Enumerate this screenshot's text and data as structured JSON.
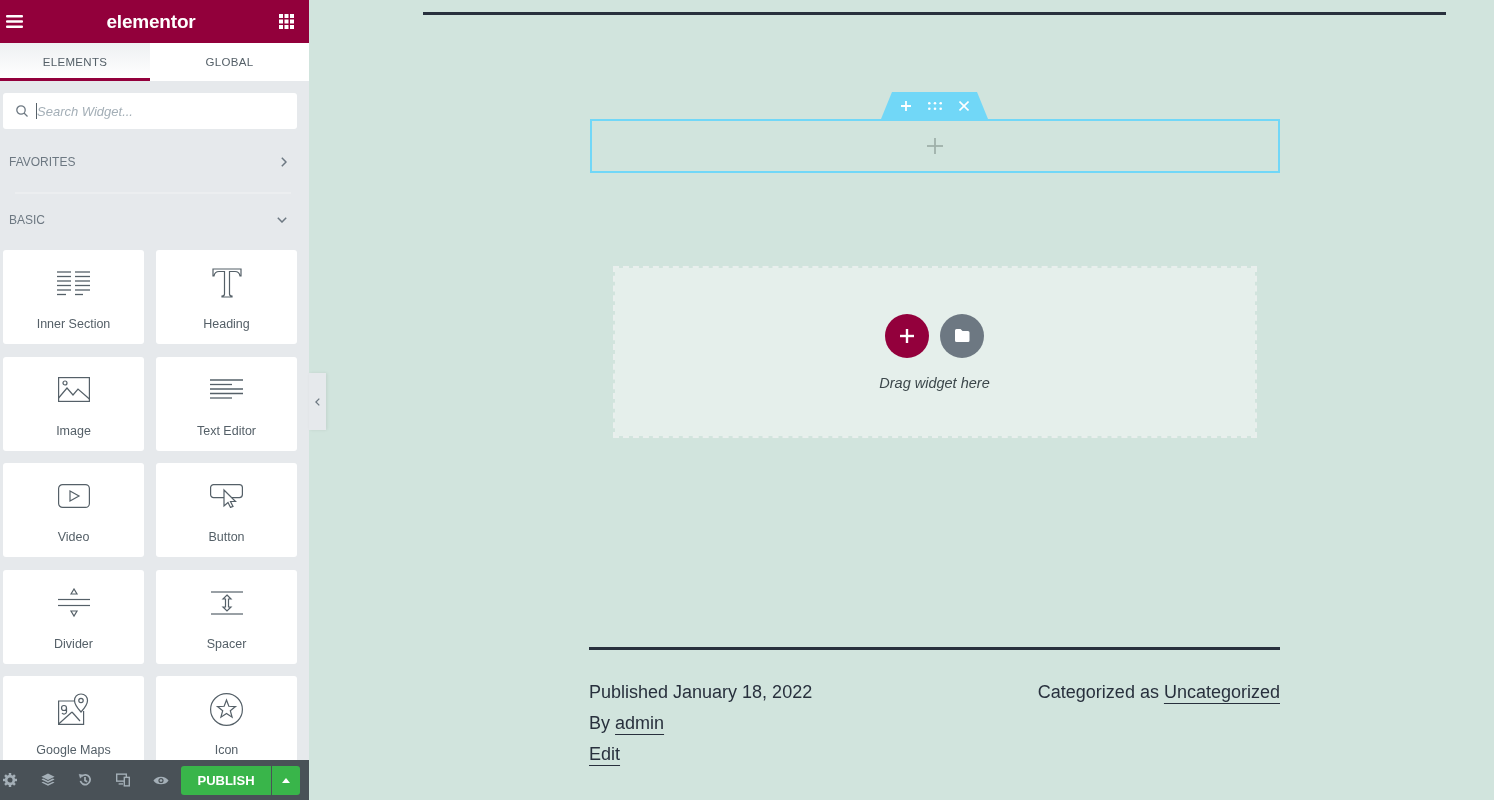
{
  "panel": {
    "logo": "elementor",
    "tabs": [
      {
        "label": "ELEMENTS",
        "selected": true
      },
      {
        "label": "GLOBAL",
        "selected": false
      }
    ],
    "search": {
      "placeholder": "Search Widget...",
      "focused": true
    },
    "categories": [
      {
        "title": "FAVORITES",
        "expanded": false
      },
      {
        "title": "BASIC",
        "expanded": true,
        "widgets": [
          "Inner Section",
          "Heading",
          "Image",
          "Text Editor",
          "Video",
          "Button",
          "Divider",
          "Spacer",
          "Google Maps",
          "Icon"
        ]
      }
    ],
    "publish_button": "PUBLISH"
  },
  "canvas": {
    "section": {
      "selected": true
    },
    "drop_area": {
      "hint": "Drag widget here"
    },
    "post_meta": {
      "published": "Published January 18, 2022",
      "category": {
        "label": "Categorized as",
        "link": "Uncategorized"
      },
      "author": {
        "label": "By",
        "link": "admin"
      },
      "edit_link": "Edit"
    }
  }
}
